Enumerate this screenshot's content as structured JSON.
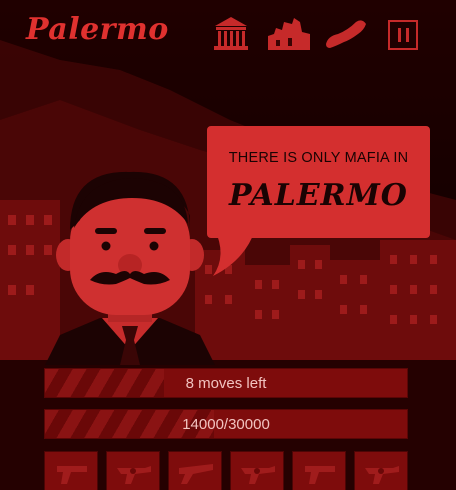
{
  "header": {
    "logo": "Palermo",
    "icons": [
      "temple-icon",
      "ruins-icon",
      "italy-boot-icon"
    ],
    "pause_icon": "pause-icon"
  },
  "speech": {
    "line1": "THERE IS ONLY MAFIA IN",
    "line2": "PALERMO"
  },
  "moves": {
    "label": "8 moves left",
    "fill": 0.33
  },
  "score": {
    "label": "14000/30000",
    "value": 14000,
    "goal": 30000
  },
  "weapons": [
    "pistol-icon",
    "revolver-icon",
    "shotgun-icon",
    "revolver-icon",
    "pistol-icon",
    "revolver-icon"
  ],
  "colors": {
    "accent": "#d42f2f",
    "dark": "#1a0303",
    "bar": "#7e0c0c"
  }
}
